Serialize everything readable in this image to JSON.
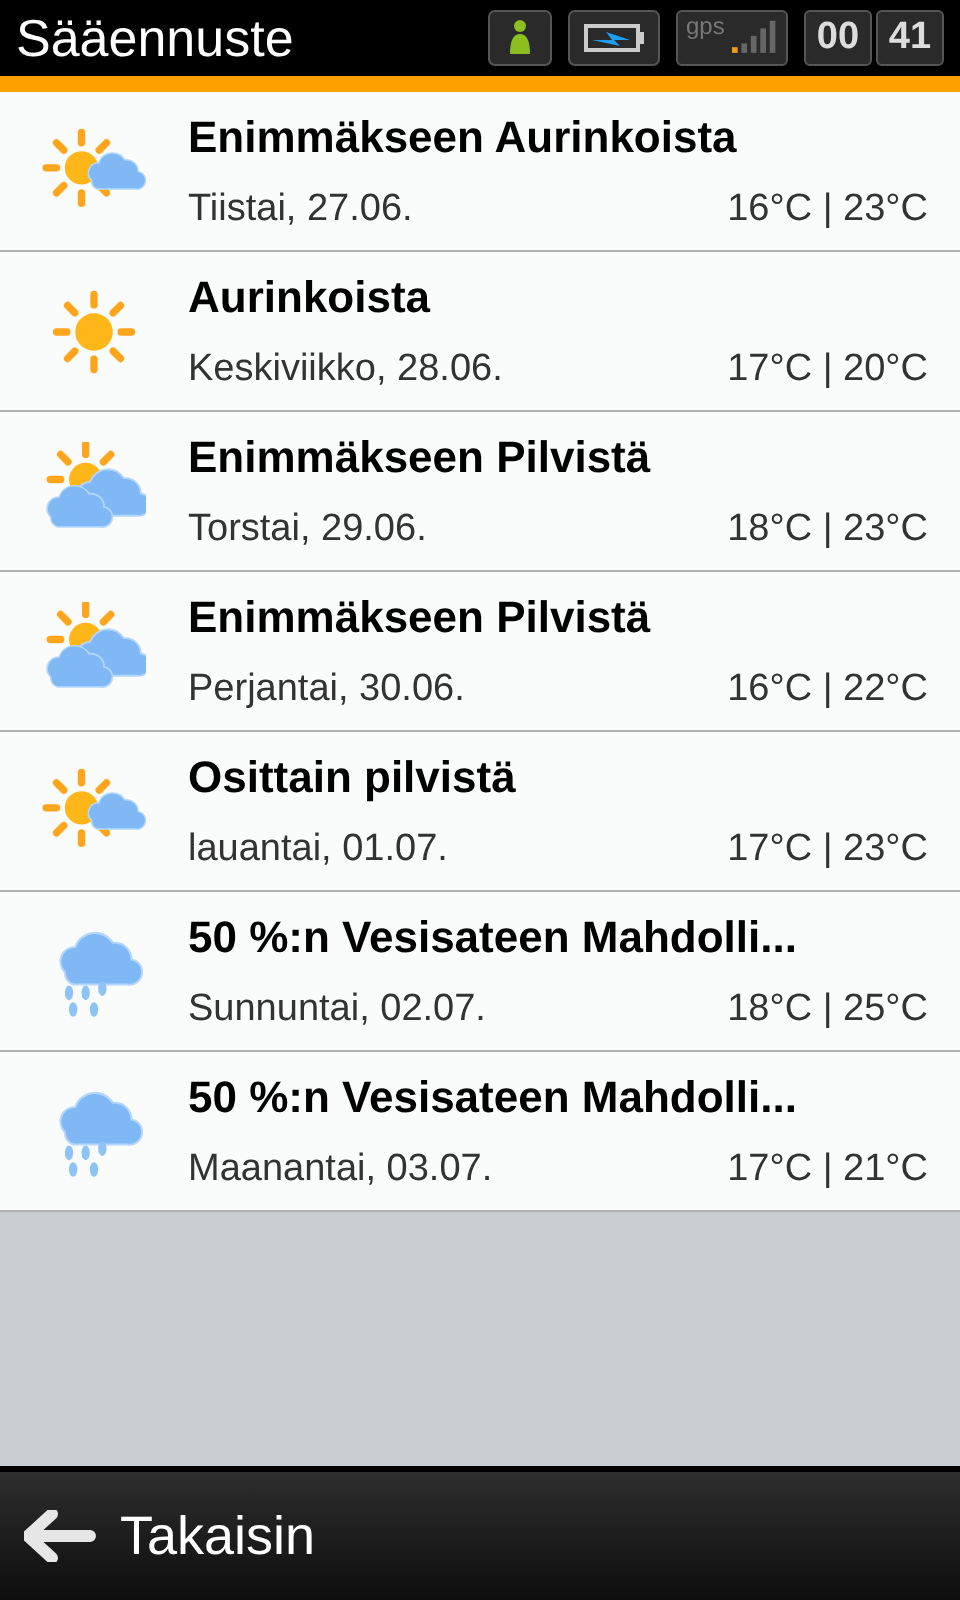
{
  "status_bar": {
    "title": "Sääennuste",
    "gps_label": "gps",
    "clock_hours": "00",
    "clock_minutes": "41"
  },
  "forecast": [
    {
      "kind": "partly_sunny",
      "condition": "Enimmäkseen Aurinkoista",
      "date": "Tiistai, 27.06.",
      "temps": "16°C | 23°C"
    },
    {
      "kind": "sunny",
      "condition": "Aurinkoista",
      "date": "Keskiviikko, 28.06.",
      "temps": "17°C | 20°C"
    },
    {
      "kind": "mostly_cloudy",
      "condition": "Enimmäkseen Pilvistä",
      "date": "Torstai, 29.06.",
      "temps": "18°C | 23°C"
    },
    {
      "kind": "mostly_cloudy",
      "condition": "Enimmäkseen Pilvistä",
      "date": "Perjantai, 30.06.",
      "temps": "16°C | 22°C"
    },
    {
      "kind": "partly_sunny",
      "condition": "Osittain pilvistä",
      "date": "lauantai, 01.07.",
      "temps": "17°C | 23°C"
    },
    {
      "kind": "rain",
      "condition": "50 %:n Vesisateen Mahdolli...",
      "date": "Sunnuntai, 02.07.",
      "temps": "18°C | 25°C"
    },
    {
      "kind": "rain",
      "condition": "50 %:n Vesisateen Mahdolli...",
      "date": "Maanantai, 03.07.",
      "temps": "17°C | 21°C"
    }
  ],
  "back_button": {
    "label": "Takaisin"
  }
}
